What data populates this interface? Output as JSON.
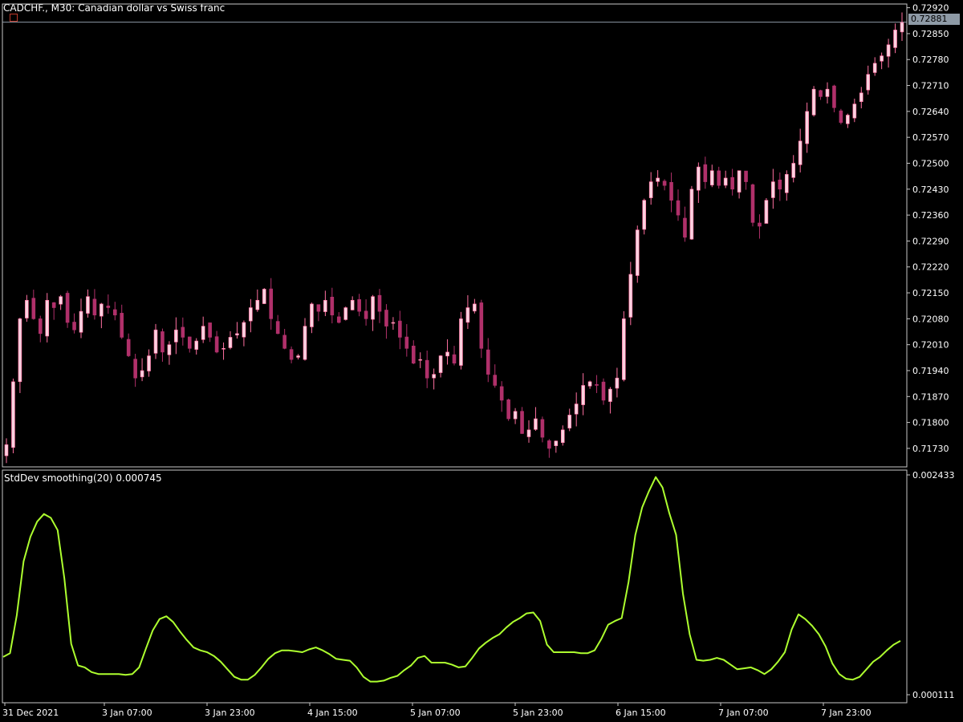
{
  "header": {
    "symbol_text": "CADCHF., M30:  Canadian dollar vs Swiss franc"
  },
  "indicator": {
    "label": "StdDev smoothing(20) 0.000745"
  },
  "colors": {
    "background": "#000000",
    "axis": "#c8c8c8",
    "bull_candle": "#7ee07e",
    "bear_candle": "#ff6fa0",
    "indicator_line": "#adff2f",
    "price_box": "#8e9aa6"
  },
  "chart_data": [
    {
      "type": "candlestick",
      "title": "CADCHF., M30:  Canadian dollar vs Swiss franc",
      "current_price": "0.72881",
      "y_ticks": [
        "0.72920",
        "0.72850",
        "0.72780",
        "0.72710",
        "0.72640",
        "0.72570",
        "0.72500",
        "0.72430",
        "0.72360",
        "0.72290",
        "0.72220",
        "0.72150",
        "0.72080",
        "0.72010",
        "0.71940",
        "0.71870",
        "0.71800",
        "0.71730"
      ],
      "ylim": [
        0.7168,
        0.7293
      ],
      "x_ticks": [
        "31 Dec 2021",
        "3 Jan 07:00",
        "3 Jan 23:00",
        "4 Jan 15:00",
        "5 Jan 07:00",
        "5 Jan 23:00",
        "6 Jan 15:00",
        "7 Jan 07:00",
        "7 Jan 23:00"
      ],
      "close_series": [
        0.7174,
        0.7191,
        0.7208,
        0.7213,
        0.7208,
        0.7204,
        0.7213,
        0.7211,
        0.7214,
        0.7207,
        0.7205,
        0.721,
        0.7214,
        0.7209,
        0.7212,
        0.7211,
        0.7209,
        0.7203,
        0.7198,
        0.7192,
        0.7194,
        0.7198,
        0.7205,
        0.7199,
        0.7201,
        0.7205,
        0.7203,
        0.72,
        0.7202,
        0.7206,
        0.7203,
        0.7199,
        0.72,
        0.7203,
        0.7204,
        0.7207,
        0.7211,
        0.7213,
        0.7216,
        0.7208,
        0.7204,
        0.72,
        0.7197,
        0.7198,
        0.7206,
        0.7212,
        0.721,
        0.7213,
        0.7209,
        0.7207,
        0.7211,
        0.7213,
        0.721,
        0.7208,
        0.7214,
        0.721,
        0.7206,
        0.7207,
        0.7203,
        0.72,
        0.7196,
        0.7197,
        0.7192,
        0.7193,
        0.7198,
        0.7199,
        0.7196,
        0.7208,
        0.7211,
        0.7212,
        0.72,
        0.7193,
        0.719,
        0.7186,
        0.7181,
        0.7183,
        0.7177,
        0.7178,
        0.7181,
        0.7176,
        0.7173,
        0.7175,
        0.7178,
        0.7182,
        0.7185,
        0.719,
        0.7191,
        0.719,
        0.7186,
        0.7189,
        0.7192,
        0.7208,
        0.722,
        0.7232,
        0.724,
        0.7245,
        0.7246,
        0.7244,
        0.724,
        0.7236,
        0.723,
        0.7243,
        0.7249,
        0.7245,
        0.7248,
        0.7244,
        0.7246,
        0.7243,
        0.7248,
        0.7245,
        0.7234,
        0.7233,
        0.724,
        0.7245,
        0.7243,
        0.7247,
        0.725,
        0.7256,
        0.7264,
        0.727,
        0.7268,
        0.727,
        0.7265,
        0.7261,
        0.7263,
        0.7266,
        0.7269,
        0.7274,
        0.7277,
        0.7279,
        0.7282,
        0.7286,
        0.7288
      ]
    },
    {
      "type": "line",
      "title": "StdDev smoothing(20) 0.000745",
      "series": [
        {
          "name": "",
          "values": [
            0.00051,
            0.00055,
            0.00095,
            0.00152,
            0.00178,
            0.00194,
            0.00202,
            0.00198,
            0.00185,
            0.00134,
            0.00065,
            0.00042,
            0.0004,
            0.00035,
            0.00033,
            0.00033,
            0.00033,
            0.00033,
            0.00032,
            0.00033,
            0.0004,
            0.0006,
            0.00079,
            0.00091,
            0.00094,
            0.00088,
            0.00078,
            0.00069,
            0.00061,
            0.00058,
            0.00056,
            0.00052,
            0.00046,
            0.00038,
            0.0003,
            0.00027,
            0.00027,
            0.00032,
            0.0004,
            0.00049,
            0.00055,
            0.00058,
            0.00058,
            0.00057,
            0.00056,
            0.00059,
            0.00061,
            0.00058,
            0.00054,
            0.00049,
            0.00048,
            0.00047,
            0.0004,
            0.0003,
            0.00025,
            0.00025,
            0.00026,
            0.00029,
            0.00031,
            0.00037,
            0.00042,
            0.0005,
            0.00052,
            0.00045,
            0.00045,
            0.00045,
            0.00043,
            0.0004,
            0.00041,
            0.0005,
            0.0006,
            0.00066,
            0.00071,
            0.00075,
            0.00082,
            0.00088,
            0.00092,
            0.00097,
            0.00098,
            0.00089,
            0.00064,
            0.00056,
            0.00056,
            0.00056,
            0.00056,
            0.00055,
            0.00055,
            0.00058,
            0.0007,
            0.00085,
            0.00089,
            0.00092,
            0.0013,
            0.0018,
            0.00209,
            0.00226,
            0.00241,
            0.0023,
            0.00203,
            0.0018,
            0.00118,
            0.00075,
            0.00048,
            0.00047,
            0.00048,
            0.0005,
            0.00048,
            0.00043,
            0.00038,
            0.00039,
            0.0004,
            0.00037,
            0.00033,
            0.00038,
            0.00046,
            0.00056,
            0.0008,
            0.00096,
            0.00091,
            0.00084,
            0.00075,
            0.00062,
            0.00044,
            0.00033,
            0.00028,
            0.00027,
            0.0003,
            0.00038,
            0.00046,
            0.00051,
            0.00058,
            0.00064,
            0.00068
          ]
        }
      ],
      "y_ticks": [
        "0.002433",
        "0.000111"
      ],
      "ylim": [
        0.000111,
        0.002433
      ]
    }
  ]
}
